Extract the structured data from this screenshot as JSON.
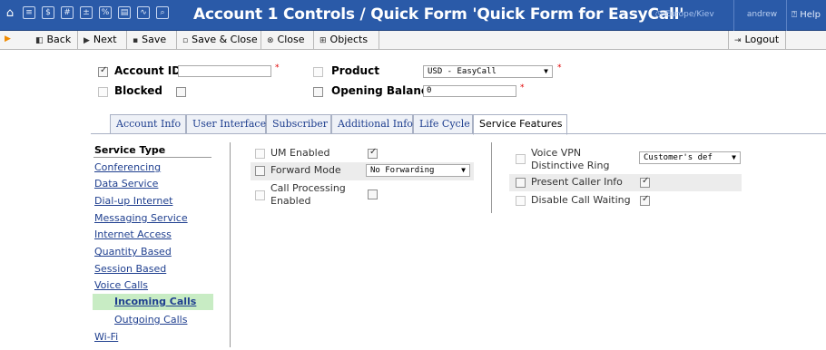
{
  "window": {
    "title": "Account 1 Controls / Quick Form 'Quick Form for EasyCall'",
    "timezone": "Europe/Kiev",
    "user": "andrew",
    "help_label": "Help",
    "toolbar_icons": [
      "list-icon",
      "dollar-icon",
      "grid-icon",
      "calc-icon",
      "rates-icon",
      "tariff-icon",
      "chart-icon",
      "search-icon"
    ]
  },
  "toolbar": {
    "back": "Back",
    "next": "Next",
    "save": "Save",
    "save_close": "Save & Close",
    "close": "Close",
    "objects": "Objects",
    "logout": "Logout"
  },
  "header": {
    "account_id_label": "Account ID",
    "account_id_value": "",
    "account_id_checked": true,
    "blocked_label": "Blocked",
    "blocked_checked": false,
    "product_label": "Product",
    "product_value": "USD - EasyCall",
    "opening_balance_label": "Opening Balance",
    "opening_balance_value": "0",
    "required_mark": "*"
  },
  "tabs": [
    {
      "label": "Account Info",
      "active": false
    },
    {
      "label": "User Interface",
      "active": false
    },
    {
      "label": "Subscriber",
      "active": false
    },
    {
      "label": "Additional Info",
      "active": false
    },
    {
      "label": "Life Cycle",
      "active": false
    },
    {
      "label": "Service Features",
      "active": true
    }
  ],
  "nav": {
    "title": "Service Type",
    "items": [
      "Conferencing",
      "Data Service",
      "Dial-up Internet",
      "Messaging Service",
      "Internet Access",
      "Quantity Based",
      "Session Based",
      "Voice Calls"
    ],
    "sub_items": [
      "Incoming Calls",
      "Outgoing Calls"
    ],
    "active_sub": "Incoming Calls",
    "last_item": "Wi-Fi"
  },
  "features_left": [
    {
      "label": "UM Enabled",
      "checked": true
    },
    {
      "label": "Forward Mode",
      "value": "No Forwarding"
    },
    {
      "label": "Call Processing Enabled",
      "line1": "Call Processing",
      "line2": "Enabled",
      "checked": false
    }
  ],
  "features_right": [
    {
      "label": "Voice VPN Distinctive Ring",
      "line1": "Voice VPN",
      "line2": "Distinctive Ring",
      "value": "Customer's def"
    },
    {
      "label": "Present Caller Info",
      "checked": true
    },
    {
      "label": "Disable Call Waiting",
      "checked": true
    }
  ],
  "colors": {
    "titlebar": "#2a5aa8",
    "link": "#1f3f8f",
    "active_nav": "#c8ecc4",
    "required": "#e00000"
  }
}
